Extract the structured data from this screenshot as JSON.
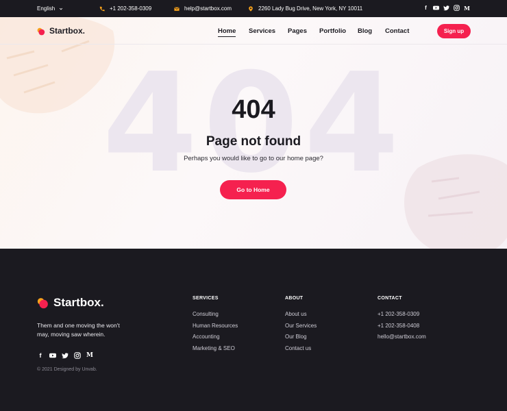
{
  "topbar": {
    "language": "English",
    "phone": "+1 202-358-0309",
    "email": "help@startbox.com",
    "address": "2260 Lady Bug Drive, New York, NY 10011",
    "socials": [
      "facebook-icon",
      "youtube-icon",
      "twitter-icon",
      "instagram-icon",
      "medium-icon"
    ]
  },
  "brand": {
    "name": "Startbox.",
    "colors": {
      "accent": "#f5214f",
      "dark": "#1b1a20",
      "pin": "#f7a21b"
    }
  },
  "nav": {
    "items": [
      "Home",
      "Services",
      "Pages",
      "Portfolio",
      "Blog",
      "Contact"
    ],
    "active": "Home",
    "signup": "Sign up"
  },
  "hero": {
    "bg_code": "404",
    "code": "404",
    "title": "Page not found",
    "subtitle": "Perhaps you would like to go to our home page?",
    "button": "Go to Home"
  },
  "footer": {
    "logo": "Startbox.",
    "description": "Them and one moving the won't may, moving saw wherein.",
    "copyright": "© 2021 Designed by Unvab.",
    "columns": [
      {
        "title": "SERVICES",
        "items": [
          "Consulting",
          "Human Resources",
          "Accounting",
          "Marketing & SEO"
        ]
      },
      {
        "title": "ABOUT",
        "items": [
          "About us",
          "Our Services",
          "Our Blog",
          "Contact us"
        ]
      },
      {
        "title": "CONTACT",
        "items": [
          "+1 202-358-0309",
          "+1 202-358-0408",
          "hello@startbox.com"
        ]
      }
    ]
  }
}
